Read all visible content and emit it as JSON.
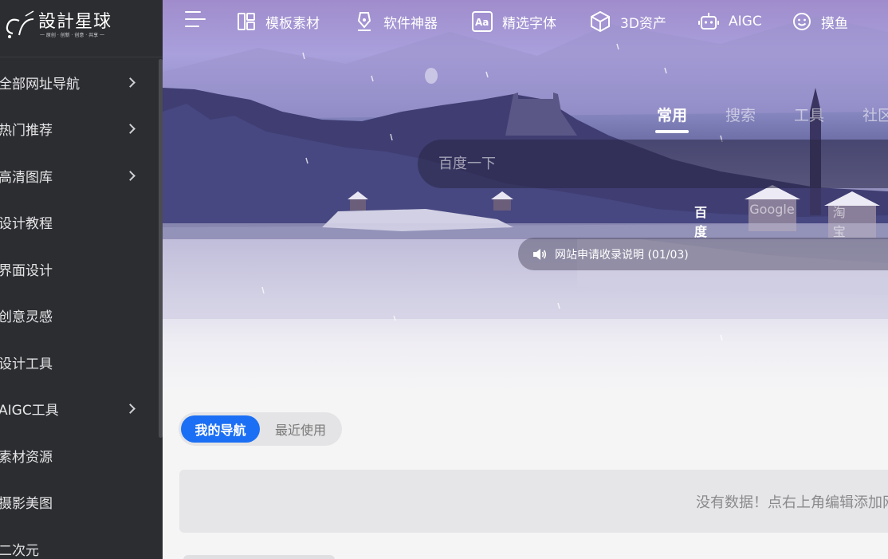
{
  "logo": {
    "text": "設計星球",
    "slogan": "一 原创 · 创新 · 创意 · 共享 一"
  },
  "sidebar": {
    "items": [
      {
        "label": "全部网址导航",
        "has_children": true
      },
      {
        "label": "热门推荐",
        "has_children": true
      },
      {
        "label": "高清图库",
        "has_children": true
      },
      {
        "label": "设计教程",
        "has_children": false
      },
      {
        "label": "界面设计",
        "has_children": false
      },
      {
        "label": "创意灵感",
        "has_children": false
      },
      {
        "label": "设计工具",
        "has_children": false
      },
      {
        "label": "AIGC工具",
        "has_children": true
      },
      {
        "label": "素材资源",
        "has_children": false
      },
      {
        "label": "摄影美图",
        "has_children": false
      },
      {
        "label": "二次元",
        "has_children": false
      }
    ]
  },
  "topnav": {
    "items": [
      {
        "label": "模板素材",
        "icon": "layout-icon"
      },
      {
        "label": "软件神器",
        "icon": "pen-icon"
      },
      {
        "label": "精选字体",
        "icon": "font-icon"
      },
      {
        "label": "3D资产",
        "icon": "cube-icon"
      },
      {
        "label": "AIGC",
        "icon": "robot-icon"
      },
      {
        "label": "摸鱼",
        "icon": "smile-icon"
      }
    ]
  },
  "search": {
    "tabs": [
      "常用",
      "搜索",
      "工具",
      "社区"
    ],
    "active_tab": "常用",
    "placeholder": "百度一下",
    "engines": [
      "百度",
      "Google",
      "淘宝"
    ],
    "active_engine": "百度"
  },
  "notice": {
    "text": "网站申请收录说明 (01/03)"
  },
  "content": {
    "segments": [
      "我的导航",
      "最近使用"
    ],
    "active_segment": "我的导航",
    "empty_text": "没有数据！点右上角编辑添加网址"
  },
  "colors": {
    "sidebar_bg": "#2c2d30",
    "accent": "#1b6ff4"
  }
}
